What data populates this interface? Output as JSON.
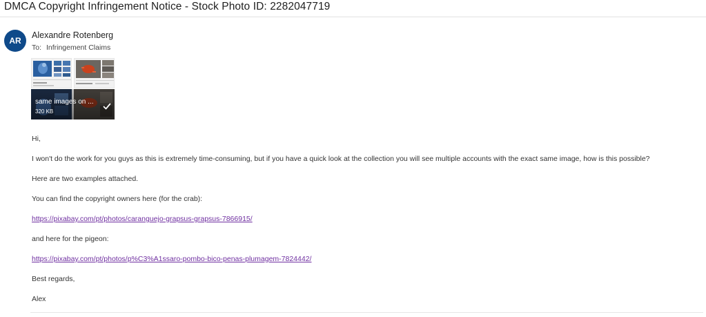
{
  "email": {
    "subject": "DMCA Copyright Infringement Notice - Stock Photo ID: 2282047719",
    "sender": {
      "initials": "AR",
      "name": "Alexandre Rotenberg",
      "avatar_color": "#0f4a8a"
    },
    "to": {
      "label": "To:",
      "value": "Infringement Claims"
    },
    "attachment": {
      "name": "same images on ...",
      "size": "320 KB",
      "icon": "check-icon"
    },
    "body": {
      "greeting": "Hi,",
      "p1": "I won't do the work for you guys as this is extremely time-consuming, but if you have a quick look at the collection you will see multiple accounts with the exact same image, how is this possible?",
      "p2": "Here are two examples attached.",
      "p3": "You can find the copyright owners here (for the crab):",
      "link1": "https://pixabay.com/pt/photos/caranguejo-grapsus-grapsus-7866915/",
      "p4": "and here for the pigeon:",
      "link2": "https://pixabay.com/pt/photos/p%C3%A1ssaro-pombo-bico-penas-plumagem-7824442/",
      "closing": "Best regards,",
      "signature": "Alex"
    },
    "colors": {
      "link": "#6f2fa0",
      "accent": "#0f4a8a"
    }
  }
}
